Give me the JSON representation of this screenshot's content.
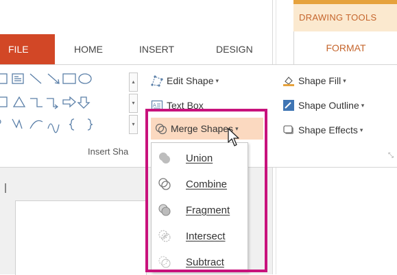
{
  "contextual_tab_group": {
    "label": "DRAWING TOOLS",
    "accent": "#e6a23c"
  },
  "tabs": {
    "file": "FILE",
    "home": "HOME",
    "insert": "INSERT",
    "design": "DESIGN",
    "format": "FORMAT"
  },
  "insert_shapes": {
    "group_label": "Insert Sha",
    "edit_shape": "Edit Shape",
    "text_box": "Text Box",
    "merge_shapes": "Merge Shapes"
  },
  "shape_styles": {
    "shape_fill": "Shape Fill",
    "shape_outline": "Shape Outline",
    "shape_effects": "Shape Effects"
  },
  "merge_menu": {
    "items": [
      {
        "label": "Union",
        "icon": "union-icon"
      },
      {
        "label": "Combine",
        "icon": "combine-icon"
      },
      {
        "label": "Fragment",
        "icon": "fragment-icon"
      },
      {
        "label": "Intersect",
        "icon": "intersect-icon"
      },
      {
        "label": "Subtract",
        "icon": "subtract-icon"
      }
    ]
  },
  "colors": {
    "file_tab": "#d24726",
    "highlight_border": "#c8127c",
    "merge_hover": "#fbd9c0",
    "format_text": "#c5652c"
  }
}
